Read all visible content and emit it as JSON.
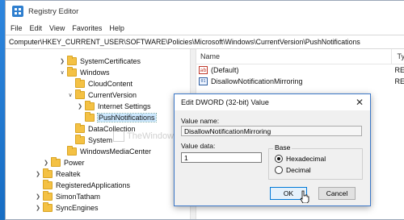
{
  "window": {
    "title": "Registry Editor"
  },
  "menu": [
    "File",
    "Edit",
    "View",
    "Favorites",
    "Help"
  ],
  "address": "Computer\\HKEY_CURRENT_USER\\SOFTWARE\\Policies\\Microsoft\\Windows\\CurrentVersion\\PushNotifications",
  "tree": [
    "SystemCertificates",
    "Windows",
    "CloudContent",
    "CurrentVersion",
    "Internet Settings",
    "PushNotifications",
    "DataCollection",
    "System",
    "WindowsMediaCenter",
    "Power",
    "Realtek",
    "RegisteredApplications",
    "SimonTatham",
    "SyncEngines"
  ],
  "values_pane": {
    "col_name": "Name",
    "col_type": "Ty",
    "rows": [
      {
        "name": "(Default)",
        "type": "RE"
      },
      {
        "name": "DisallowNotificationMirroring",
        "type": "RE"
      }
    ]
  },
  "watermark": "TheWindowsClub",
  "dialog": {
    "title": "Edit DWORD (32-bit) Value",
    "value_name_label": "Value name:",
    "value_name": "DisallowNotificationMirroring",
    "value_data_label": "Value data:",
    "value_data": "1",
    "base_label": "Base",
    "hex_label": "Hexadecimal",
    "dec_label": "Decimal",
    "ok": "OK",
    "cancel": "Cancel"
  }
}
